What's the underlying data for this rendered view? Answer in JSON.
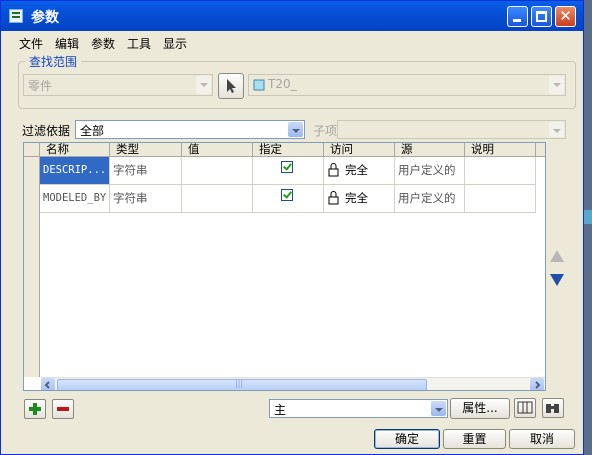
{
  "window": {
    "title": "参数"
  },
  "menu": [
    "文件",
    "编辑",
    "参数",
    "工具",
    "显示"
  ],
  "find_scope": {
    "legend": "查找范围",
    "type_value": "零件",
    "model_value": "T20_"
  },
  "filter": {
    "label": "过滤依据",
    "value": "全部",
    "subitem_label": "子项",
    "subitem_value": ""
  },
  "table": {
    "columns": [
      "名称",
      "类型",
      "值",
      "指定",
      "访问",
      "源",
      "说明"
    ],
    "rows": [
      {
        "name": "DESCRIP...",
        "type": "字符串",
        "value": "",
        "designated": true,
        "access": "完全",
        "source": "用户定义的",
        "description": ""
      },
      {
        "name": "MODELED_BY",
        "type": "字符串",
        "value": "",
        "designated": true,
        "access": "完全",
        "source": "用户定义的",
        "description": ""
      }
    ],
    "scroll_label": "|||"
  },
  "bottom": {
    "main_value": "主",
    "properties_label": "属性...",
    "ok_label": "确定",
    "reset_label": "重置",
    "cancel_label": "取消"
  },
  "icons": {
    "add": "plus-icon",
    "remove": "minus-icon",
    "pointer": "arrow-cursor-icon",
    "model": "part-icon",
    "up": "triangle-up-icon",
    "down": "triangle-down-icon"
  },
  "colors": {
    "add": "#1f8a1f",
    "remove": "#c01818",
    "selection": "#316ac5",
    "title_bar": "#0650d6"
  }
}
